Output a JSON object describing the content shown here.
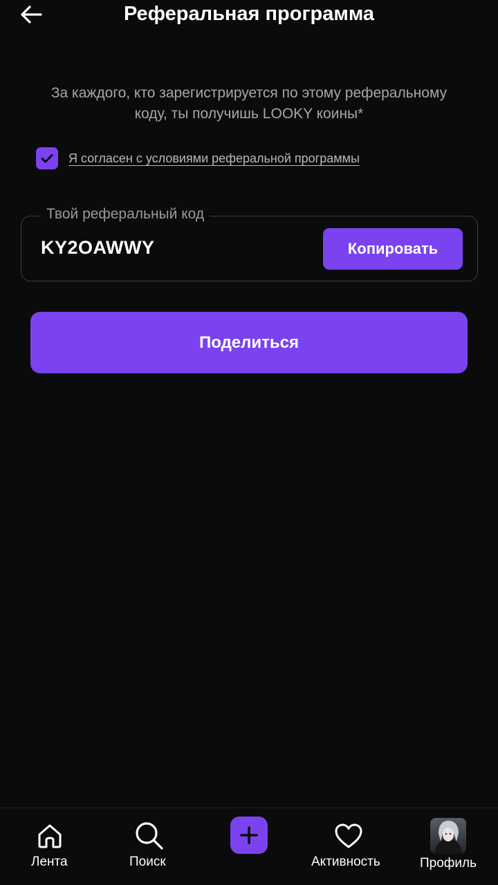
{
  "header": {
    "title": "Реферальная программа",
    "back_icon": "arrow-left-icon"
  },
  "description": "За каждого, кто зарегистрируется по этому реферальному коду, ты получишь LOOKY коины*",
  "consent": {
    "checked": true,
    "label": "Я согласен с условиями реферальной программы"
  },
  "referral": {
    "legend": "Твой реферальный код",
    "code": "KY2OAWWY",
    "copy_label": "Копировать"
  },
  "share_label": "Поделиться",
  "tabbar": {
    "feed": {
      "label": "Лента",
      "icon": "home-icon"
    },
    "search": {
      "label": "Поиск",
      "icon": "search-icon"
    },
    "create": {
      "icon": "plus-icon"
    },
    "activity": {
      "label": "Активность",
      "icon": "heart-icon"
    },
    "profile": {
      "label": "Профиль",
      "icon": "avatar"
    }
  },
  "colors": {
    "accent": "#7b43ef",
    "background": "#0b0b0c",
    "muted_text": "#a7a7ab"
  }
}
